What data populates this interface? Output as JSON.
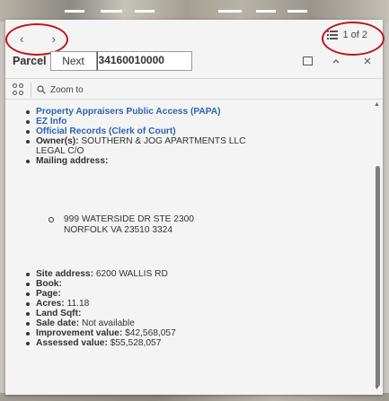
{
  "popup": {
    "nav": {
      "prev": "‹",
      "next": "›"
    },
    "feature_count": "1 of 2",
    "title": "Parcel",
    "next_button": "Next",
    "parcel_id": "34160010000",
    "zoom_to": "Zoom to"
  },
  "content": {
    "link_papa": "Property Appraisers Public Access (PAPA)",
    "link_ezinfo": "EZ Info",
    "link_official": "Official Records (Clerk of Court)",
    "owner_label": "Owner(s):",
    "owner_value": "SOUTHERN & JOG APARTMENTS LLC",
    "owner_value2": "LEGAL C/O",
    "mailing_label": "Mailing address:",
    "mailing_line1": "999 WATERSIDE DR STE 2300",
    "mailing_line2": "NORFOLK VA 23510 3324",
    "site_label": "Site address:",
    "site_value": "6200 WALLIS RD",
    "book_label": "Book:",
    "page_label": "Page:",
    "acres_label": "Acres:",
    "acres_value": "11.18",
    "sqft_label": "Land Sqft:",
    "sale_label": "Sale date:",
    "sale_value": "Not available",
    "improve_label": "Improvement value:",
    "improve_value": "$42,568,057",
    "assessed_label": "Assessed value:",
    "assessed_value": "$55,528,057"
  },
  "colors": {
    "link": "#2e64b4",
    "annotation": "#c0141b"
  },
  "icons": [
    "prev-arrow-icon",
    "next-arrow-icon",
    "list-icon",
    "dock-icon",
    "collapse-icon",
    "close-icon",
    "actions-icon",
    "zoom-icon"
  ]
}
